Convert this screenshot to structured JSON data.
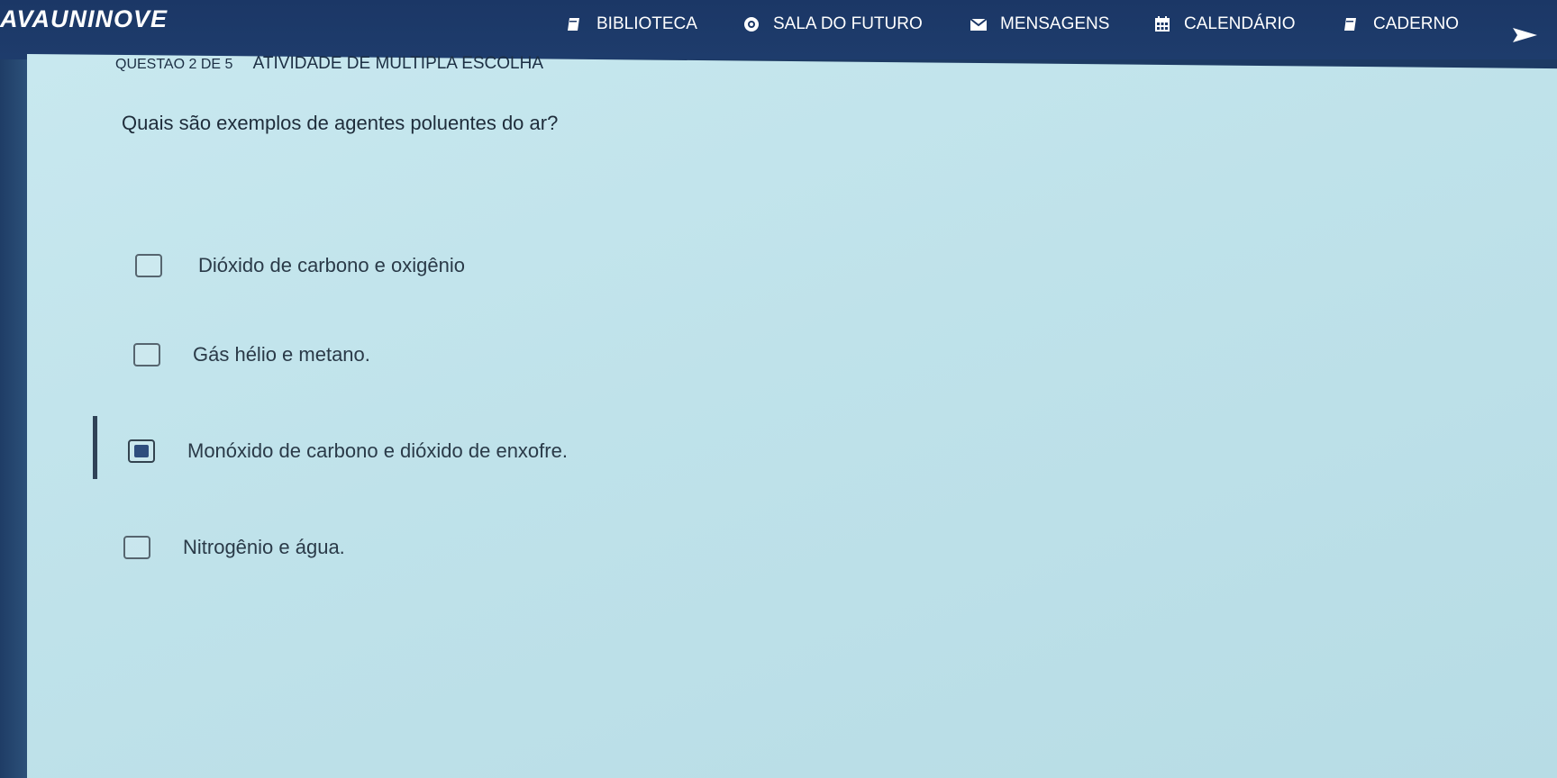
{
  "app": {
    "logo": "AVAUNINOVE"
  },
  "nav": {
    "items": [
      {
        "label": "BIBLIOTECA",
        "icon": "book-icon"
      },
      {
        "label": "SALA DO FUTURO",
        "icon": "target-icon"
      },
      {
        "label": "MENSAGENS",
        "icon": "mail-icon"
      },
      {
        "label": "CALENDÁRIO",
        "icon": "calendar-icon"
      },
      {
        "label": "CADERNO",
        "icon": "notebook-icon"
      }
    ]
  },
  "question": {
    "counter": "QUESTAO 2 DE 5",
    "type": "ATIVIDADE DE MULTIPLA ESCOLHA",
    "text": "Quais são exemplos de agentes poluentes do ar?",
    "options": [
      {
        "label": "Dióxido de carbono e oxigênio",
        "checked": false
      },
      {
        "label": "Gás hélio e metano.",
        "checked": false
      },
      {
        "label": "Monóxido de carbono e dióxido de enxofre.",
        "checked": true
      },
      {
        "label": "Nitrogênio e água.",
        "checked": false
      }
    ]
  },
  "colors": {
    "topbar": "#1b3766",
    "content_bg": "#c2e4ec",
    "checked_fill": "#2e4e7e"
  }
}
